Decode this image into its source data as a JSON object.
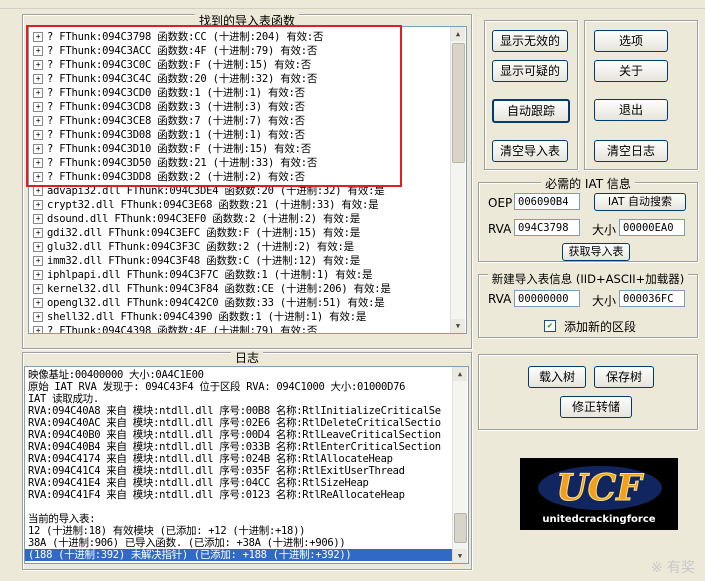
{
  "imports_panel": {
    "title": "找到的导入表函数",
    "rows": [
      "? FThunk:094C3798 函数数:CC (十进制:204) 有效:否",
      "? FThunk:094C3ACC 函数数:4F (十进制:79) 有效:否",
      "? FThunk:094C3C0C 函数数:F (十进制:15) 有效:否",
      "? FThunk:094C3C4C 函数数:20 (十进制:32) 有效:否",
      "? FThunk:094C3CD0 函数数:1 (十进制:1) 有效:否",
      "? FThunk:094C3CD8 函数数:3 (十进制:3) 有效:否",
      "? FThunk:094C3CE8 函数数:7 (十进制:7) 有效:否",
      "? FThunk:094C3D08 函数数:1 (十进制:1) 有效:否",
      "? FThunk:094C3D10 函数数:F (十进制:15) 有效:否",
      "? FThunk:094C3D50 函数数:21 (十进制:33) 有效:否",
      "? FThunk:094C3DD8 函数数:2 (十进制:2) 有效:否",
      "advapi32.dll FThunk:094C3DE4 函数数:20 (十进制:32) 有效:是",
      "crypt32.dll FThunk:094C3E68 函数数:21 (十进制:33) 有效:是",
      "dsound.dll FThunk:094C3EF0 函数数:2 (十进制:2) 有效:是",
      "gdi32.dll FThunk:094C3EFC 函数数:F (十进制:15) 有效:是",
      "glu32.dll FThunk:094C3F3C 函数数:2 (十进制:2) 有效:是",
      "imm32.dll FThunk:094C3F48 函数数:C (十进制:12) 有效:是",
      "iphlpapi.dll FThunk:094C3F7C 函数数:1 (十进制:1) 有效:是",
      "kernel32.dll FThunk:094C3F84 函数数:CE (十进制:206) 有效:是",
      "opengl32.dll FThunk:094C42C0 函数数:33 (十进制:51) 有效:是",
      "shell32.dll FThunk:094C4390 函数数:1 (十进制:1) 有效:是",
      "? FThunk:094C4398 函数数:4F (十进制:79) 有效:否"
    ]
  },
  "buttons": {
    "show_invalid": "显示无效的",
    "show_suspect": "显示可疑的",
    "auto_trace": "自动跟踪",
    "clear_imports": "清空导入表",
    "options": "选项",
    "about": "关于",
    "exit": "退出",
    "clear_log": "清空日志",
    "iat_autosearch": "IAT 自动搜索",
    "get_imports": "获取导入表",
    "load_tree": "载入树",
    "save_tree": "保存树",
    "fix_dump": "修正转储"
  },
  "iat_info": {
    "title": "必需的 IAT 信息",
    "oep_label": "OEP",
    "oep_value": "006090B4",
    "rva_label": "RVA",
    "rva_value": "094C3798",
    "size_label": "大小",
    "size_value": "00000EA0"
  },
  "new_iat": {
    "title": "新建导入表信息 (IID+ASCII+加载器)",
    "rva_label": "RVA",
    "rva_value": "00000000",
    "size_label": "大小",
    "size_value": "000036FC",
    "add_section_label": "添加新的区段",
    "add_section_checked": true
  },
  "log_panel": {
    "title": "日志",
    "lines": [
      "映像基址:00400000 大小:0A4C1E00",
      "原始 IAT RVA 发现于: 094C43F4 位于区段 RVA: 094C1000 大小:01000D76",
      "IAT 读取成功.",
      "RVA:094C40A8 来自 模块:ntdll.dll 序号:00B8 名称:RtlInitializeCriticalSe",
      "RVA:094C40AC 来自 模块:ntdll.dll 序号:02E6 名称:RtlDeleteCriticalSectio",
      "RVA:094C40B0 来自 模块:ntdll.dll 序号:00D4 名称:RtlLeaveCriticalSection",
      "RVA:094C40B4 来自 模块:ntdll.dll 序号:033B 名称:RtlEnterCriticalSection",
      "RVA:094C4174 来自 模块:ntdll.dll 序号:024B 名称:RtlAllocateHeap",
      "RVA:094C41C4 来自 模块:ntdll.dll 序号:035F 名称:RtlExitUserThread",
      "RVA:094C41E4 来自 模块:ntdll.dll 序号:04CC 名称:RtlSizeHeap",
      "RVA:094C41F4 来自 模块:ntdll.dll 序号:0123 名称:RtlReAllocateHeap",
      "",
      "当前的导入表:",
      "12 (十进制:18) 有效模块 (已添加: +12 (十进制:+18))",
      "38A (十进制:906) 已导入函数. (已添加: +38A (十进制:+906))",
      "(188 (十进制:392) 未解决指针) (已添加: +188 (十进制:+392))"
    ]
  },
  "logo": {
    "text": "unitedcrackingforce",
    "mark": "UCF"
  },
  "watermark": "※ 有奖"
}
